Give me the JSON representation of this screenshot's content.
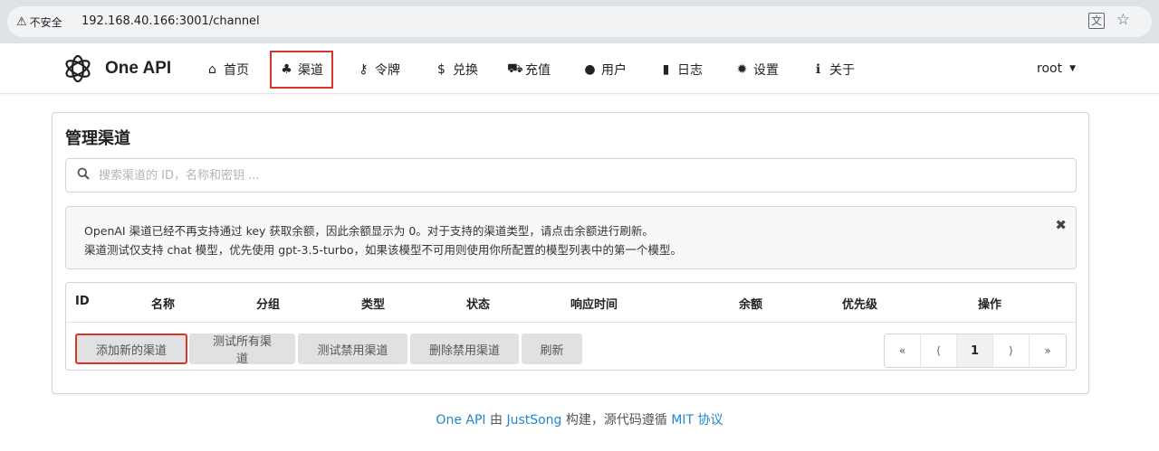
{
  "browser": {
    "insecure_label": "不安全",
    "url": "192.168.40.166:3001/channel"
  },
  "nav": {
    "brand": "One API",
    "items": [
      {
        "label": "首页",
        "icon": "home-icon",
        "glyph": "⌂"
      },
      {
        "label": "渠道",
        "icon": "sitemap-icon",
        "glyph": "♣"
      },
      {
        "label": "令牌",
        "icon": "key-icon",
        "glyph": "⚷"
      },
      {
        "label": "兑换",
        "icon": "dollar-icon",
        "glyph": "$"
      },
      {
        "label": "充值",
        "icon": "cart-icon",
        "glyph": "⛟"
      },
      {
        "label": "用户",
        "icon": "user-icon",
        "glyph": "●"
      },
      {
        "label": "日志",
        "icon": "book-icon",
        "glyph": "▮"
      },
      {
        "label": "设置",
        "icon": "gear-icon",
        "glyph": "✹"
      },
      {
        "label": "关于",
        "icon": "info-icon",
        "glyph": "ℹ"
      }
    ],
    "user": "root"
  },
  "card": {
    "title": "管理渠道",
    "search_placeholder": "搜索渠道的 ID，名称和密钥 ...",
    "notice": {
      "line1": "OpenAI 渠道已经不再支持通过 key 获取余额，因此余额显示为 0。对于支持的渠道类型，请点击余额进行刷新。",
      "line2": "渠道测试仅支持 chat 模型，优先使用 gpt-3.5-turbo，如果该模型不可用则使用你所配置的模型列表中的第一个模型。"
    },
    "table": {
      "headers": [
        "ID",
        "名称",
        "分组",
        "类型",
        "状态",
        "响应时间",
        "余额",
        "优先级",
        "操作"
      ]
    },
    "buttons": {
      "add": "添加新的渠道",
      "test_all": "测试所有渠道",
      "test_disabled": "测试禁用渠道",
      "delete_disabled": "删除禁用渠道",
      "refresh": "刷新"
    },
    "pager": {
      "first": "«",
      "prev": "⟨",
      "page": "1",
      "next": "⟩",
      "last": "»"
    }
  },
  "footer": {
    "app": "One API",
    "by": " 由 ",
    "author": "JustSong",
    "built": " 构建，源代码遵循 ",
    "license": "MIT 协议"
  },
  "colors": {
    "highlight": "#d9342b",
    "link": "#2185d0",
    "button_bg": "#e0e1e2"
  }
}
